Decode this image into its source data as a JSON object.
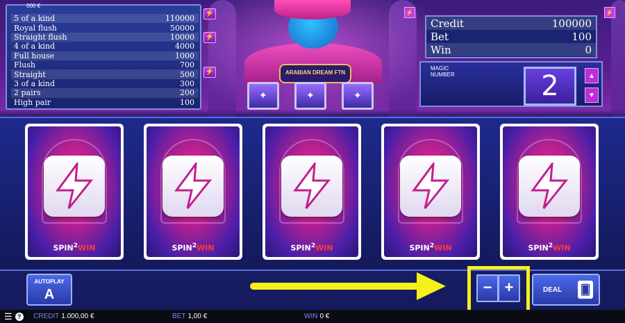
{
  "paytable": {
    "top_value": "000 €",
    "rows": [
      {
        "hand": "5 of a kind",
        "payout": "110000"
      },
      {
        "hand": "Royal flush",
        "payout": "50000"
      },
      {
        "hand": "Straight flush",
        "payout": "10000"
      },
      {
        "hand": "4 of a kind",
        "payout": "4000"
      },
      {
        "hand": "Full house",
        "payout": "1000"
      },
      {
        "hand": "Flush",
        "payout": "700"
      },
      {
        "hand": "Straight",
        "payout": "500"
      },
      {
        "hand": "3 of a kind",
        "payout": "300"
      },
      {
        "hand": "2 pairs",
        "payout": "200"
      },
      {
        "hand": "High pair",
        "payout": "100"
      }
    ]
  },
  "info": {
    "credit_label": "Credit",
    "credit_value": "100000",
    "bet_label": "Bet",
    "bet_value": "100",
    "win_label": "Win",
    "win_value": "0"
  },
  "magic": {
    "label": "MAGIC NUMBER",
    "value": "2"
  },
  "genie_logo": "ARABIAN DREAM FTN",
  "cards": [
    {
      "brand": "SPIN",
      "brand_sup": "2",
      "brand_win": "WIN"
    },
    {
      "brand": "SPIN",
      "brand_sup": "2",
      "brand_win": "WIN"
    },
    {
      "brand": "SPIN",
      "brand_sup": "2",
      "brand_win": "WIN"
    },
    {
      "brand": "SPIN",
      "brand_sup": "2",
      "brand_win": "WIN"
    },
    {
      "brand": "SPIN",
      "brand_sup": "2",
      "brand_win": "WIN"
    }
  ],
  "controls": {
    "autoplay_label": "AUTOPLAY",
    "autoplay_icon": "A",
    "minus_label": "−",
    "plus_label": "+",
    "deal_label": "DEAL",
    "deal_icon": "🂠"
  },
  "status": {
    "credit_label": "CREDIT",
    "credit_value": "1.000,00 €",
    "bet_label": "BET",
    "bet_value": "1,00 €",
    "win_label": "WIN",
    "win_value": "0 €",
    "help": "?"
  },
  "colors": {
    "highlight": "#f5f01a",
    "accent": "#c43be0",
    "panel": "#1a2470"
  }
}
